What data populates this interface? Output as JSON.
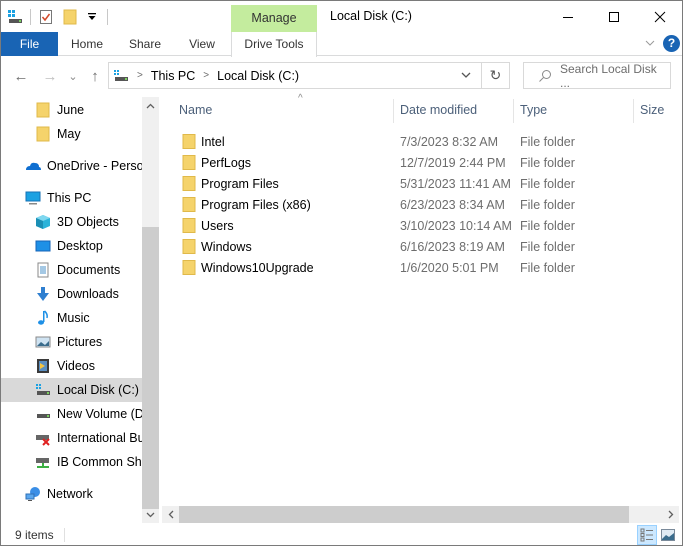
{
  "window": {
    "title": "Local Disk (C:)",
    "contextual_tab_group": "Manage",
    "controls": {
      "minimize": "minimize",
      "maximize": "maximize",
      "close": "close"
    }
  },
  "quick_access_toolbar": {
    "icons": [
      "drive-icon",
      "properties-icon",
      "new-folder-icon",
      "customize-dropdown-icon"
    ]
  },
  "ribbon": {
    "tabs": [
      {
        "label": "File",
        "active": false,
        "style": "file"
      },
      {
        "label": "Home"
      },
      {
        "label": "Share"
      },
      {
        "label": "View"
      },
      {
        "label": "Drive Tools",
        "contextual": true
      }
    ],
    "collapse_icon": "chevron-down",
    "help_icon": "?"
  },
  "navigation": {
    "back": "←",
    "forward": "→",
    "recent": "⌄",
    "up": "↑",
    "breadcrumb": [
      "This PC",
      "Local Disk (C:)"
    ],
    "address_dropdown": "⌄",
    "refresh": "↻",
    "search_placeholder": "Search Local Disk ..."
  },
  "sidebar": {
    "items": [
      {
        "label": "June",
        "icon": "folder"
      },
      {
        "label": "May",
        "icon": "folder"
      },
      {
        "label": "OneDrive - Personal",
        "icon": "onedrive"
      },
      {
        "label": "This PC",
        "icon": "pc"
      },
      {
        "label": "3D Objects",
        "icon": "3d"
      },
      {
        "label": "Desktop",
        "icon": "desktop"
      },
      {
        "label": "Documents",
        "icon": "documents"
      },
      {
        "label": "Downloads",
        "icon": "downloads"
      },
      {
        "label": "Music",
        "icon": "music"
      },
      {
        "label": "Pictures",
        "icon": "pictures"
      },
      {
        "label": "Videos",
        "icon": "videos"
      },
      {
        "label": "Local Disk (C:)",
        "icon": "localdisk",
        "selected": true
      },
      {
        "label": "New Volume (D:)",
        "icon": "drive"
      },
      {
        "label": "International Business",
        "icon": "netdrive-disconnected"
      },
      {
        "label": "IB Common Share",
        "icon": "netdrive"
      },
      {
        "label": "Network",
        "icon": "network"
      }
    ]
  },
  "file_list": {
    "columns": [
      "Name",
      "Date modified",
      "Type",
      "Size"
    ],
    "sort_indicator": "^",
    "rows": [
      {
        "name": "Intel",
        "date": "7/3/2023 8:32 AM",
        "type": "File folder",
        "size": ""
      },
      {
        "name": "PerfLogs",
        "date": "12/7/2019 2:44 PM",
        "type": "File folder",
        "size": ""
      },
      {
        "name": "Program Files",
        "date": "5/31/2023 11:41 AM",
        "type": "File folder",
        "size": ""
      },
      {
        "name": "Program Files (x86)",
        "date": "6/23/2023 8:34 AM",
        "type": "File folder",
        "size": ""
      },
      {
        "name": "Users",
        "date": "3/10/2023 10:14 AM",
        "type": "File folder",
        "size": ""
      },
      {
        "name": "Windows",
        "date": "6/16/2023 8:19 AM",
        "type": "File folder",
        "size": ""
      },
      {
        "name": "Windows10Upgrade",
        "date": "1/6/2020 5:01 PM",
        "type": "File folder",
        "size": ""
      }
    ]
  },
  "status_bar": {
    "item_count": "9 items",
    "views": [
      "details",
      "large-icons"
    ],
    "active_view": "details"
  },
  "colors": {
    "file_tab": "#1964b4",
    "manage_tab": "#c4ec9e",
    "selected_nav": "#d9d9d9",
    "header_text": "#4c607a",
    "folder": "#f5d36b"
  }
}
